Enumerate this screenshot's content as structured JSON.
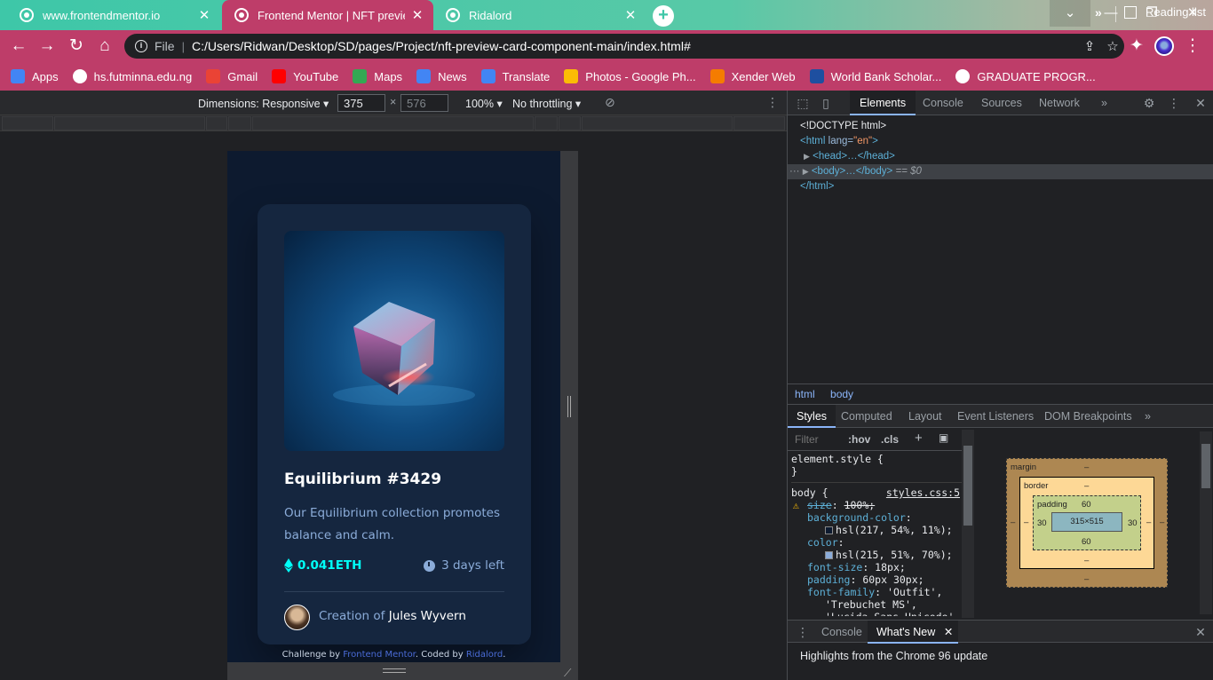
{
  "browser": {
    "tabs": [
      {
        "title": "www.frontendmentor.io",
        "active": false
      },
      {
        "title": "Frontend Mentor | NFT preview c",
        "active": true
      },
      {
        "title": "Ridalord",
        "active": false
      }
    ],
    "address": {
      "scheme_label": "File",
      "url": "C:/Users/Ridwan/Desktop/SD/pages/Project/nft-preview-card-component-main/index.html#"
    },
    "bookmarks": [
      {
        "label": "Apps",
        "icon": "apps-grid-icon",
        "color": "#4285f4"
      },
      {
        "label": "hs.futminna.edu.ng",
        "icon": "globe-icon",
        "color": "#ffffff"
      },
      {
        "label": "Gmail",
        "icon": "gmail-icon",
        "color": "#ea4335"
      },
      {
        "label": "YouTube",
        "icon": "youtube-icon",
        "color": "#ff0000"
      },
      {
        "label": "Maps",
        "icon": "maps-icon",
        "color": "#34a853"
      },
      {
        "label": "News",
        "icon": "news-icon",
        "color": "#4285f4"
      },
      {
        "label": "Translate",
        "icon": "translate-icon",
        "color": "#4285f4"
      },
      {
        "label": "Photos - Google Ph...",
        "icon": "photos-icon",
        "color": "#fbbc05"
      },
      {
        "label": "Xender Web",
        "icon": "xender-icon",
        "color": "#f57c00"
      },
      {
        "label": "World Bank Scholar...",
        "icon": "worldbank-icon",
        "color": "#1e4fa0"
      },
      {
        "label": "GRADUATE PROGR...",
        "icon": "globe-icon",
        "color": "#ffffff"
      }
    ],
    "reading_list": "Reading list",
    "more_bookmarks": "»"
  },
  "device_toolbar": {
    "dimensions_label": "Dimensions: Responsive",
    "width": "375",
    "height": "576",
    "zoom": "100%",
    "throttling": "No throttling"
  },
  "card": {
    "title": "Equilibrium #3429",
    "description": "Our Equilibrium collection promotes balance and calm.",
    "price": "0.041ETH",
    "time_left": "3 days left",
    "creator_prefix": "Creation of ",
    "creator_name": "Jules Wyvern",
    "attribution_prefix": "Challenge by ",
    "attribution_link1": "Frontend Mentor",
    "attribution_mid": ". Coded by ",
    "attribution_link2": "Ridalord",
    "attribution_suffix": "."
  },
  "devtools": {
    "tabs": [
      "Elements",
      "Console",
      "Sources",
      "Network",
      "»"
    ],
    "dom": {
      "doctype": "<!DOCTYPE html>",
      "html_open_tag": "<html",
      "html_attr_name": " lang=",
      "html_attr_value": "\"en\"",
      "html_close_bracket": ">",
      "head": "<head>…</head>",
      "body": "<body>…</body>",
      "body_suffix": " == $0",
      "html_close": "</html>",
      "dots": "···"
    },
    "breadcrumb": [
      "html",
      "body"
    ],
    "style_tabs": [
      "Styles",
      "Computed",
      "Layout",
      "Event Listeners",
      "DOM Breakpoints",
      "»"
    ],
    "filter_placeholder": "Filter",
    "hov": ":hov",
    "cls": ".cls",
    "styles": {
      "element_style": "element.style {",
      "close_brace": "}",
      "body_selector": "body {",
      "source": "styles.css:5",
      "rules": [
        {
          "prop": "size",
          "value": "100%;",
          "struck": true
        },
        {
          "prop": "background-color",
          "value": "hsl(217, 54%, 11%);",
          "swatch": "#0d1a2f"
        },
        {
          "prop": "color",
          "value": "hsl(215, 51%, 70%);",
          "swatch": "#8bacd9"
        },
        {
          "prop": "font-size",
          "value": "18px;"
        },
        {
          "prop": "padding",
          "value": "60px 30px;"
        },
        {
          "prop": "font-family",
          "value": "'Outfit',"
        },
        {
          "prop": "",
          "value": "'Trebuchet MS',"
        },
        {
          "prop": "",
          "value": "'Lucida Sans Unicode',"
        }
      ]
    },
    "box_model": {
      "margin_label": "margin",
      "border_label": "border",
      "padding_label": "padding",
      "dash": "–",
      "padding_top": "60",
      "padding_bottom": "60",
      "padding_left": "30",
      "padding_right": "30",
      "content": "315×515"
    },
    "drawer": {
      "tabs": [
        "Console",
        "What's New"
      ],
      "active": "What's New",
      "content": "Highlights from the Chrome 96 update"
    }
  }
}
